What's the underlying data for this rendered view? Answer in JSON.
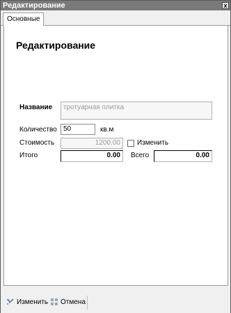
{
  "window": {
    "title": "Редактирование",
    "close_glyph": "x"
  },
  "tabs": [
    {
      "label": "Основные"
    }
  ],
  "form": {
    "heading": "Редактирование",
    "name": {
      "label": "Название",
      "value": "тротуарная плитка"
    },
    "quantity": {
      "label": "Количество",
      "value": "50",
      "unit": "кв.м"
    },
    "cost": {
      "label": "Стоимость",
      "value": "1200.00",
      "checkbox_label": "Изменить",
      "checked": false
    },
    "total": {
      "label": "Итого",
      "value": "0.00"
    },
    "grand_total": {
      "label": "Всего",
      "value": "0.00"
    }
  },
  "footer": {
    "save_label": "Изменить",
    "cancel_label": "Отмена",
    "save_icon": "edit-icon",
    "cancel_icon": "cancel-grid-icon"
  }
}
